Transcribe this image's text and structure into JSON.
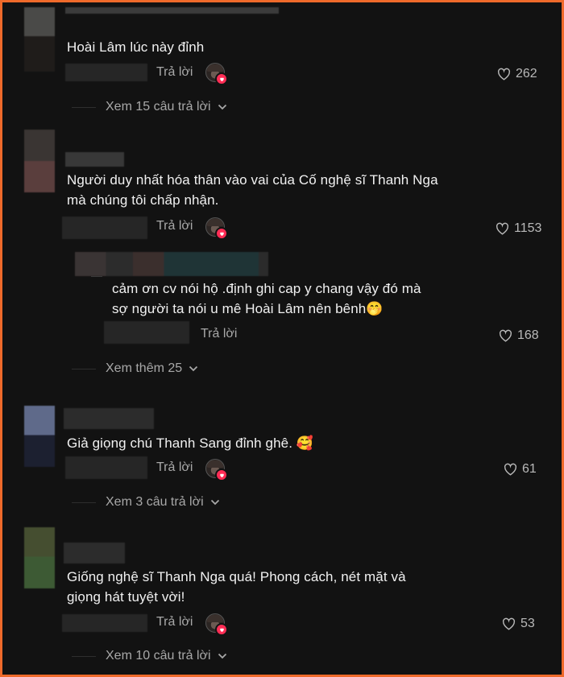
{
  "colors": {
    "background": "#121212",
    "border": "#ef6a2b",
    "text": "#f1f1f1",
    "muted": "#a8a8a8",
    "heart": "#ff2d55"
  },
  "comments": [
    {
      "text": "Hoài Lâm lúc này đỉnh",
      "reply_label": "Trả lời",
      "likes": "262",
      "view_replies": "Xem 15 câu trả lời"
    },
    {
      "text_line1": "Người duy nhất hóa thân vào vai của Cố nghệ sĩ Thanh Nga",
      "text_line2": "mà chúng tôi chấp nhận.",
      "reply_label": "Trả lời",
      "likes": "1153",
      "reply": {
        "text_line1": "cảm ơn cv nói hộ .định ghi cap y chang vậy đó mà",
        "text_line2": "sợ người ta nói u mê Hoài Lâm nên bênh",
        "emoji": "🤭",
        "reply_label": "Trả lời",
        "likes": "168"
      },
      "view_replies": "Xem thêm 25"
    },
    {
      "text": "Giả giọng chú Thanh Sang đỉnh ghê.",
      "emoji": "🥰",
      "reply_label": "Trả lời",
      "likes": "61",
      "view_replies": "Xem 3 câu trả lời"
    },
    {
      "text_line1": "Giống nghệ sĩ Thanh Nga quá! Phong cách, nét mặt và",
      "text_line2": "giọng hát tuyệt vời!",
      "reply_label": "Trả lời",
      "likes": "53",
      "view_replies": "Xem 10 câu trả lời"
    }
  ],
  "icons": {
    "like": "heart-outline-icon",
    "expand": "chevron-down-icon",
    "creator_liked": "creator-heart-badge-icon"
  }
}
